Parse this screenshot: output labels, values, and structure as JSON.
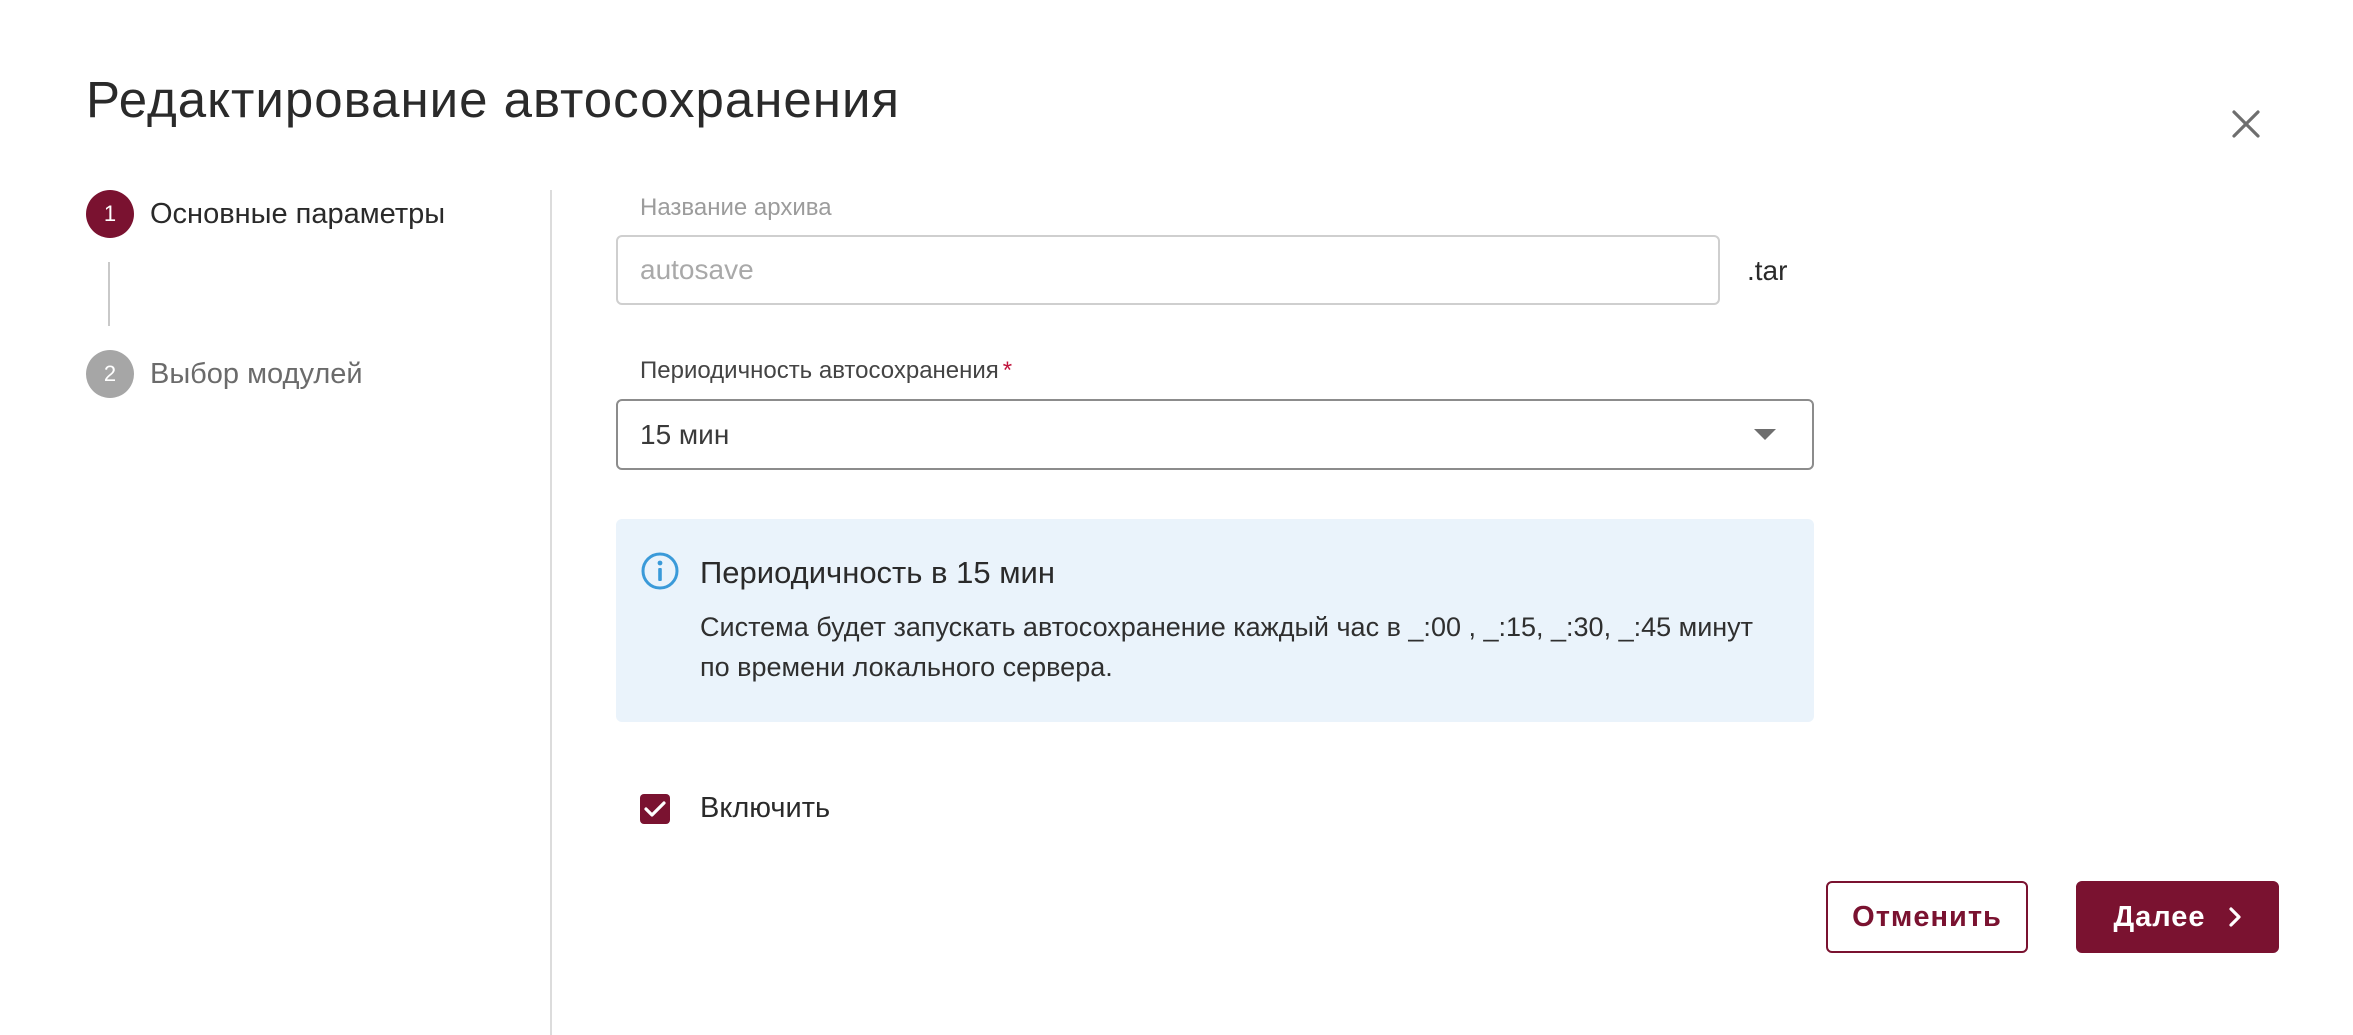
{
  "dialog": {
    "title": "Редактирование автосохранения"
  },
  "stepper": {
    "steps": [
      {
        "number": "1",
        "label": "Основные параметры",
        "state": "active"
      },
      {
        "number": "2",
        "label": "Выбор модулей",
        "state": "inactive"
      }
    ]
  },
  "form": {
    "archive_name": {
      "label": "Название архива",
      "value": "",
      "placeholder": "autosave",
      "suffix": ".tar"
    },
    "period": {
      "label": "Периодичность автосохранения",
      "required_mark": "*",
      "selected": "15 мин"
    }
  },
  "info": {
    "title": "Периодичность в 15 мин",
    "text": "Система будет запускать автосохранение каждый час в _:00 , _:15, _:30, _:45 минут по времени локального сервера."
  },
  "enable": {
    "label": "Включить",
    "checked": true
  },
  "buttons": {
    "cancel": "Отменить",
    "next": "Далее"
  },
  "colors": {
    "accent": "#7a1230",
    "info_bg": "#eaf3fb",
    "info_icon": "#3a9ad9",
    "required": "#c0143c"
  },
  "icons": {
    "close": "close-icon",
    "caret": "caret-down-icon",
    "info": "info-icon",
    "check": "check-icon",
    "next": "chevron-right-icon"
  }
}
